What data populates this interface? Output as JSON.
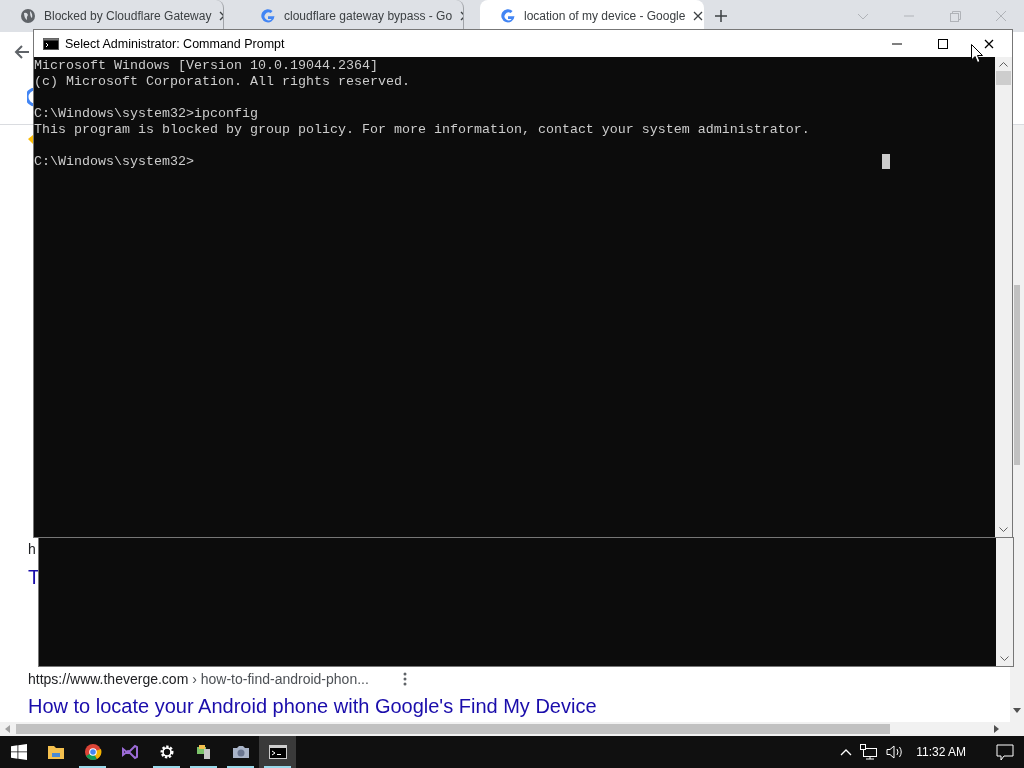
{
  "browser": {
    "tabs": [
      {
        "title": "Blocked by Cloudflare Gateway",
        "kind": "globe",
        "selected": false
      },
      {
        "title": "cloudflare gateway bypass - Go",
        "kind": "google",
        "selected": false
      },
      {
        "title": "location of my device - Google",
        "kind": "google",
        "selected": true
      }
    ],
    "page_fragments": [
      {
        "kind": "url",
        "text": "h"
      },
      {
        "kind": "title",
        "text": "T"
      }
    ],
    "result": {
      "url": "https://www.theverge.com",
      "path": "› how-to-find-android-phon...",
      "title": "How to locate your Android phone with Google's Find My Device"
    }
  },
  "console_window": {
    "title": "Select Administrator:  Command Prompt",
    "blocks": [
      [
        "Microsoft Windows [Version 10.0.19044.2364]",
        "(c) Microsoft Corporation. All rights reserved."
      ],
      [
        "C:\\Windows\\system32>ipconfig",
        "This program is blocked by group policy. For more information, contact your system administrator."
      ],
      [
        "C:\\Windows\\system32>"
      ]
    ]
  },
  "taskbar": {
    "apps": [
      {
        "kind": "explorer",
        "running": false,
        "selected": false
      },
      {
        "kind": "chrome",
        "running": true,
        "selected": false
      },
      {
        "kind": "studio",
        "running": false,
        "selected": false
      },
      {
        "kind": "settings",
        "running": true,
        "selected": false
      },
      {
        "kind": "tools",
        "running": true,
        "selected": false
      },
      {
        "kind": "camera",
        "running": true,
        "selected": false
      },
      {
        "kind": "console",
        "running": true,
        "selected": true
      }
    ],
    "clock": "11:32 AM"
  }
}
